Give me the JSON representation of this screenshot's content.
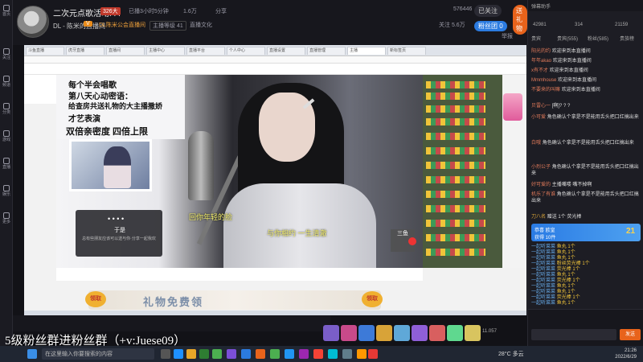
{
  "header": {
    "stream_title": "二次元点歌活动! ! !",
    "level_badge": "326大",
    "time": "已播3小时5分钟",
    "viewer_count": "1.6万",
    "share": "分享",
    "streamer": "DL - 陈米的直播间",
    "room_badge": "V",
    "notice": "DL陈米公会直播间",
    "tag1": "主播等级 41",
    "tag2": "直播文化",
    "hot": "576446",
    "follow": "已关注",
    "follow_count": "关注 5.6万",
    "fan_button": "粉丝团 0",
    "sub_button": "直播",
    "report": "举报",
    "gift_top": "送礼物"
  },
  "rail": [
    "首页",
    "关注",
    "频道",
    "分类",
    "游戏",
    "直播",
    "娱乐",
    "更多"
  ],
  "inner_tabs": [
    "斗鱼直播",
    "虎牙直播",
    "直播间",
    "主播中心",
    "直播平台",
    "个人中心",
    "直播设置",
    "直播管理",
    "主播",
    "新标签页"
  ],
  "overlay": {
    "caption_lines": [
      "每个半会唱歌",
      "第八天心动密语：",
      "给查房共送礼物的大主播撒娇",
      "才艺表演"
    ],
    "double_line": "双倍亲密度 四倍上限",
    "popup_dots": "• • • •",
    "popup_name": "于是",
    "popup_text": "总有些朋友应该可以送与你·分享一起我欢",
    "lyric1": "回你年轻的脸",
    "lyric2": "与你相约 一生清澈",
    "channel_logo": "三鱼",
    "promo_title": "礼物免费领",
    "promo_left": "领取",
    "promo_right": "领取",
    "group_text": "5级粉丝群进粉丝群（+v:Juese09）",
    "bottom_24": "24"
  },
  "chat": {
    "header": "弹幕助手",
    "stats": [
      "42981",
      "314",
      "21159"
    ],
    "tabs": [
      "贵宾",
      "贵宾(555)",
      "粉丝(585)",
      "贵族榜"
    ],
    "messages": [
      {
        "user": "阳光的约",
        "text": "欢迎来到本直播间"
      },
      {
        "user": "年年akao",
        "text": "欢迎来到本直播间"
      },
      {
        "user": "x有不才",
        "text": "欢迎来到本直播间"
      },
      {
        "user": "Mmmhouse",
        "text": "欢迎来到本直播间"
      },
      {
        "user": "不要来的叫嘛",
        "text": "欢迎来到本直播间"
      },
      {
        "user": "贝雷心一",
        "text": "[啊]? ? ?"
      },
      {
        "user": "小可爱",
        "text": "角色确认个拿是不是能用舌头把口红搞出来"
      },
      {
        "user": "白哦",
        "text": "角色确认个拿是不是能用舌头把口红搞出来"
      },
      {
        "user": "小烈公子",
        "text": "角色确认个拿是不是能用舌头把口红搞出来"
      },
      {
        "user": "好可爱的",
        "text": "主播嘴喽 嘴不掉啊"
      },
      {
        "user": "机乐了有谁",
        "text": "角色确认个拿是不是能用舌头把口红搞出来"
      },
      {
        "user": "刀八名",
        "text": "赠送 1个 荧光棒"
      }
    ],
    "fan_card_line1": "恭喜 欧皇",
    "fan_card_line2": "获得 10件",
    "fan_card_level": "21",
    "gifts": [
      {
        "user": "一起听菜菜",
        "gift": "鱼丸 1个"
      },
      {
        "user": "一起听菜菜",
        "gift": "鱼丸 1个"
      },
      {
        "user": "一起听菜菜",
        "gift": "鱼丸 1个"
      },
      {
        "user": "一起听菜菜",
        "gift": "粉丝荧光棒 1个"
      },
      {
        "user": "一起听菜菜",
        "gift": "荧光棒 1个"
      },
      {
        "user": "一起听菜菜",
        "gift": "鱼丸 1个"
      },
      {
        "user": "一起听菜菜",
        "gift": "荧光棒 1个"
      },
      {
        "user": "一起听菜菜",
        "gift": "鱼丸 1个"
      },
      {
        "user": "一起听菜菜",
        "gift": "鱼丸 1个"
      },
      {
        "user": "一起听菜菜",
        "gift": "荧光棒 1个"
      },
      {
        "user": "一起听菜菜",
        "gift": "鱼丸 1个"
      }
    ],
    "send": "发送"
  },
  "taskbar": {
    "search_placeholder": "在这里输入你要搜索的内容",
    "temp": "28°C 多云",
    "time": "21:26",
    "date": "2022/6/29"
  },
  "tools": {
    "gift_count": "11.057"
  },
  "colors": {
    "accent": "#e8631b",
    "blue": "#2b7be0",
    "chat_user": "#e07a5a"
  }
}
